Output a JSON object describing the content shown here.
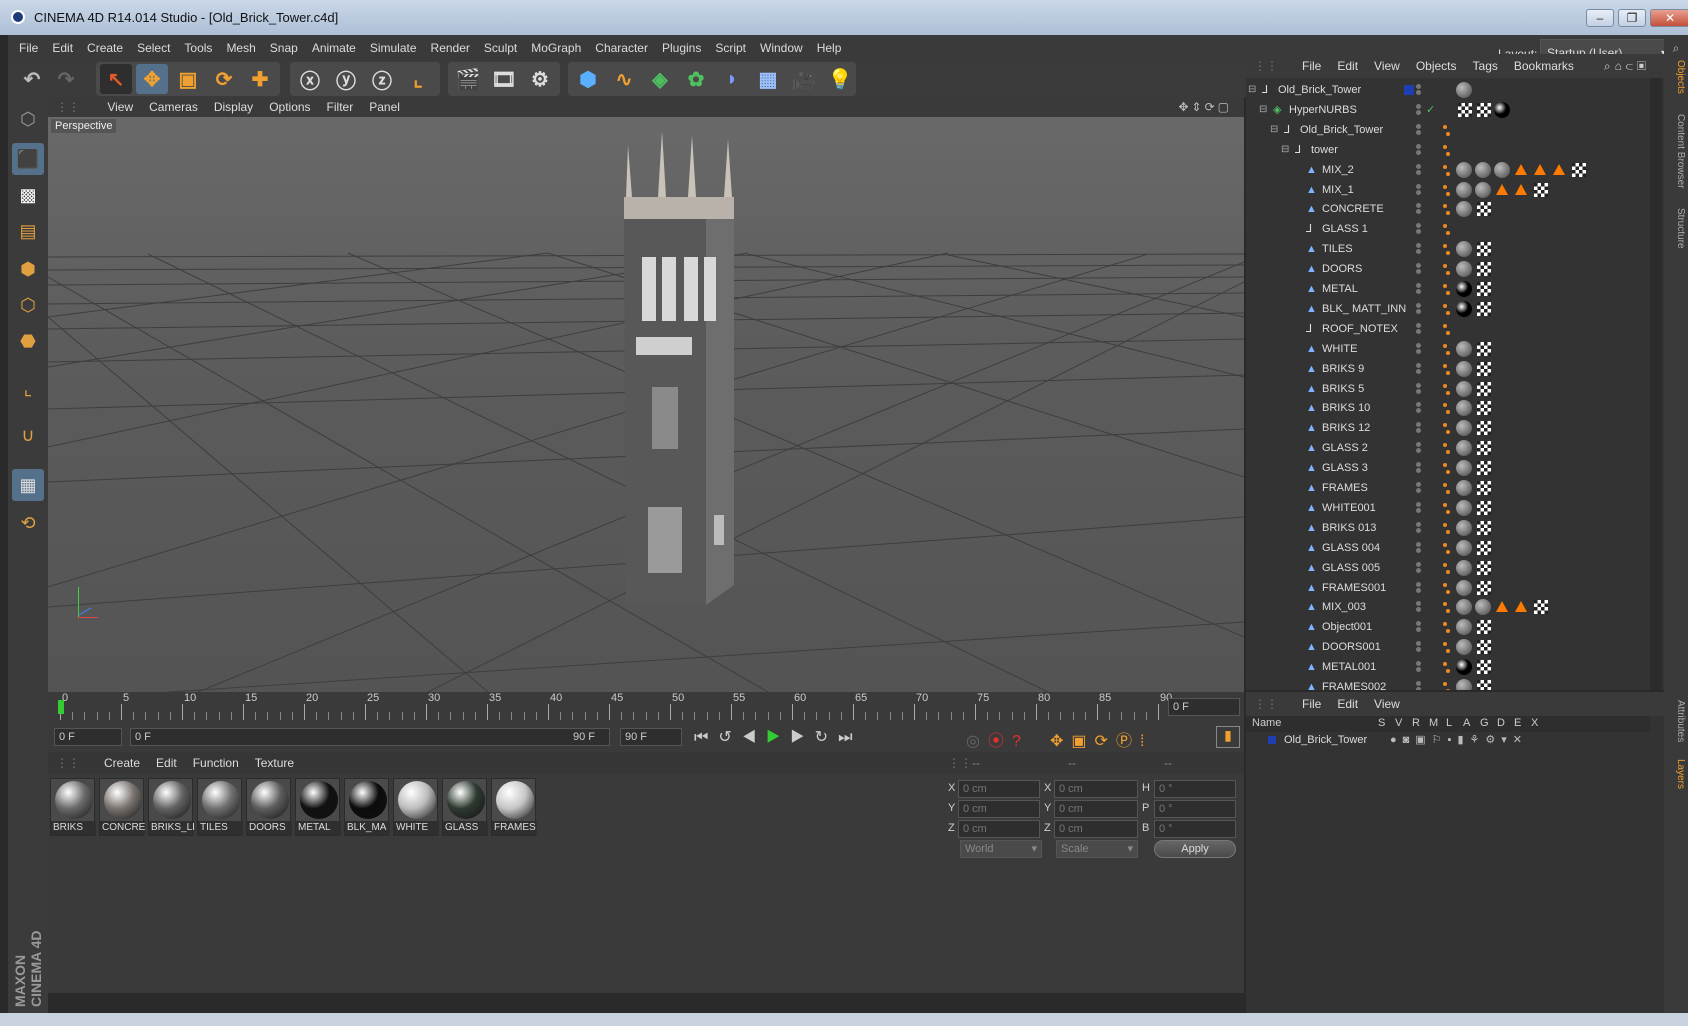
{
  "window": {
    "title": "CINEMA 4D R14.014 Studio - [Old_Brick_Tower.c4d]"
  },
  "menu": [
    "File",
    "Edit",
    "Create",
    "Select",
    "Tools",
    "Mesh",
    "Snap",
    "Animate",
    "Simulate",
    "Render",
    "Sculpt",
    "MoGraph",
    "Character",
    "Plugins",
    "Script",
    "Window",
    "Help"
  ],
  "layout": {
    "label": "Layout:",
    "value": "Startup (User)"
  },
  "viewport": {
    "menu": [
      "View",
      "Cameras",
      "Display",
      "Options",
      "Filter",
      "Panel"
    ],
    "label": "Perspective"
  },
  "timeline": {
    "ticks": [
      "0",
      "5",
      "10",
      "15",
      "20",
      "25",
      "30",
      "35",
      "40",
      "45",
      "50",
      "55",
      "60",
      "65",
      "70",
      "75",
      "80",
      "85",
      "90"
    ],
    "current_frame": "0 F",
    "start": "0 F",
    "range_start": "0 F",
    "range_end": "90 F",
    "end": "90 F"
  },
  "materials": {
    "menu": [
      "Create",
      "Edit",
      "Function",
      "Texture"
    ],
    "items": [
      {
        "name": "BRIKS",
        "color": "#6a6a6a"
      },
      {
        "name": "CONCRE",
        "color": "#7a7470"
      },
      {
        "name": "BRIKS_LI",
        "color": "#636363"
      },
      {
        "name": "TILES",
        "color": "#707070"
      },
      {
        "name": "DOORS",
        "color": "#5e5e5e"
      },
      {
        "name": "METAL",
        "color": "#111111"
      },
      {
        "name": "BLK_MA",
        "color": "#0c0c0c"
      },
      {
        "name": "WHITE",
        "color": "#bdbdbd"
      },
      {
        "name": "GLASS",
        "color": "#2e3a30"
      },
      {
        "name": "FRAMES",
        "color": "#c6c6c6"
      }
    ]
  },
  "coords": {
    "header": [
      "--",
      "--",
      "--"
    ],
    "rows": [
      {
        "a": "X",
        "av": "0 cm",
        "b": "X",
        "bv": "0 cm",
        "c": "H",
        "cv": "0 °"
      },
      {
        "a": "Y",
        "av": "0 cm",
        "b": "Y",
        "bv": "0 cm",
        "c": "P",
        "cv": "0 °"
      },
      {
        "a": "Z",
        "av": "0 cm",
        "b": "Z",
        "bv": "0 cm",
        "c": "B",
        "cv": "0 °"
      }
    ],
    "space": "World",
    "mode": "Scale",
    "apply": "Apply"
  },
  "objects": {
    "menu": [
      "File",
      "Edit",
      "View",
      "Objects",
      "Tags",
      "Bookmarks"
    ],
    "rows": [
      {
        "name": "Old_Brick_Tower",
        "indent": 0,
        "icon": "L0",
        "tags": "blue"
      },
      {
        "name": "HyperNURBS",
        "indent": 1,
        "icon": "nurbs",
        "tags": "check"
      },
      {
        "name": "Old_Brick_Tower",
        "indent": 2,
        "icon": "L0",
        "tags": ""
      },
      {
        "name": "tower",
        "indent": 3,
        "icon": "L0",
        "tags": ""
      },
      {
        "name": "MIX_2",
        "indent": 4,
        "icon": "poly",
        "tags": "bbbtttc"
      },
      {
        "name": "MIX_1",
        "indent": 4,
        "icon": "poly",
        "tags": "bbttc"
      },
      {
        "name": "CONCRETE",
        "indent": 4,
        "icon": "poly",
        "tags": "bc"
      },
      {
        "name": "GLASS 1",
        "indent": 4,
        "icon": "L0",
        "tags": ""
      },
      {
        "name": "TILES",
        "indent": 4,
        "icon": "poly",
        "tags": "bc"
      },
      {
        "name": "DOORS",
        "indent": 4,
        "icon": "poly",
        "tags": "bc"
      },
      {
        "name": "METAL",
        "indent": 4,
        "icon": "poly",
        "tags": "kc"
      },
      {
        "name": "BLK_ MATT_INN",
        "indent": 4,
        "icon": "poly",
        "tags": "kc"
      },
      {
        "name": "ROOF_NOTEX",
        "indent": 4,
        "icon": "L0",
        "tags": ""
      },
      {
        "name": "WHITE",
        "indent": 4,
        "icon": "poly",
        "tags": "bc"
      },
      {
        "name": "BRIKS 9",
        "indent": 4,
        "icon": "poly",
        "tags": "bc"
      },
      {
        "name": "BRIKS 5",
        "indent": 4,
        "icon": "poly",
        "tags": "bc"
      },
      {
        "name": "BRIKS 10",
        "indent": 4,
        "icon": "poly",
        "tags": "bc"
      },
      {
        "name": "BRIKS 12",
        "indent": 4,
        "icon": "poly",
        "tags": "bc"
      },
      {
        "name": "GLASS 2",
        "indent": 4,
        "icon": "poly",
        "tags": "bc"
      },
      {
        "name": "GLASS 3",
        "indent": 4,
        "icon": "poly",
        "tags": "bc"
      },
      {
        "name": "FRAMES",
        "indent": 4,
        "icon": "poly",
        "tags": "bc"
      },
      {
        "name": "WHITE001",
        "indent": 4,
        "icon": "poly",
        "tags": "bc"
      },
      {
        "name": "BRIKS 013",
        "indent": 4,
        "icon": "poly",
        "tags": "bc"
      },
      {
        "name": "GLASS 004",
        "indent": 4,
        "icon": "poly",
        "tags": "bc"
      },
      {
        "name": "GLASS 005",
        "indent": 4,
        "icon": "poly",
        "tags": "bc"
      },
      {
        "name": "FRAMES001",
        "indent": 4,
        "icon": "poly",
        "tags": "bc"
      },
      {
        "name": "MIX_003",
        "indent": 4,
        "icon": "poly",
        "tags": "bbttc"
      },
      {
        "name": "Object001",
        "indent": 4,
        "icon": "poly",
        "tags": "bc"
      },
      {
        "name": "DOORS001",
        "indent": 4,
        "icon": "poly",
        "tags": "bc"
      },
      {
        "name": "METAL001",
        "indent": 4,
        "icon": "poly",
        "tags": "kc"
      },
      {
        "name": "FRAMES002",
        "indent": 4,
        "icon": "poly",
        "tags": "bc"
      }
    ]
  },
  "layers": {
    "menu": [
      "File",
      "Edit",
      "View"
    ],
    "columns": [
      "Name",
      "S",
      "V",
      "R",
      "M",
      "L",
      "A",
      "G",
      "D",
      "E",
      "X"
    ],
    "row": "Old_Brick_Tower"
  },
  "side_tabs": [
    "Objects",
    "Content Browser",
    "Structure",
    "Attributes",
    "Layers"
  ],
  "brand": "MAXON CINEMA 4D"
}
